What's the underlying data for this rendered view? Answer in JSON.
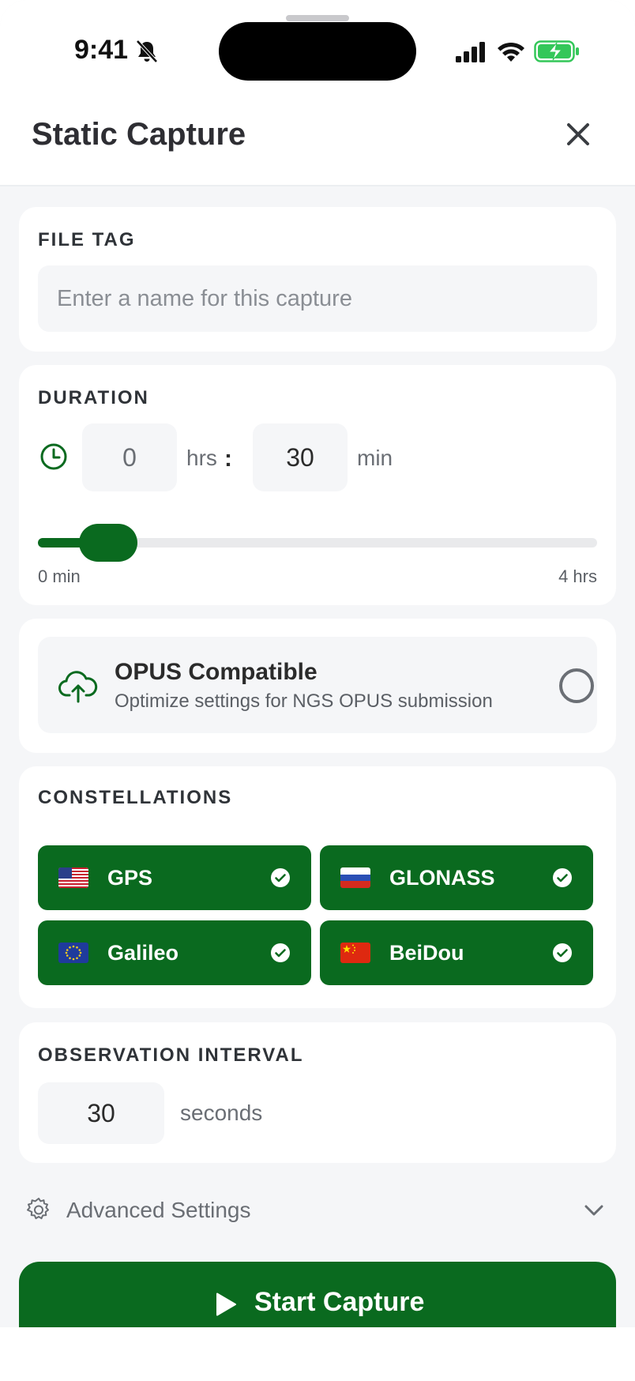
{
  "status_bar": {
    "time": "9:41"
  },
  "header": {
    "title": "Static Capture"
  },
  "file_tag": {
    "label": "FILE TAG",
    "value": "",
    "placeholder": "Enter a name for this capture"
  },
  "duration": {
    "label": "DURATION",
    "hours": "0",
    "hours_unit": "hrs",
    "separator": ":",
    "minutes": "30",
    "minutes_unit": "min",
    "slider_min_label": "0 min",
    "slider_max_label": "4 hrs",
    "slider_value_minutes": 30,
    "slider_max_minutes": 240
  },
  "opus": {
    "title": "OPUS Compatible",
    "subtitle": "Optimize settings for NGS OPUS submission",
    "selected": false
  },
  "constellations": {
    "label": "CONSTELLATIONS",
    "items": [
      {
        "name": "GPS",
        "flag": "us-flag",
        "selected": true
      },
      {
        "name": "GLONASS",
        "flag": "ru-flag",
        "selected": true
      },
      {
        "name": "Galileo",
        "flag": "eu-flag",
        "selected": true
      },
      {
        "name": "BeiDou",
        "flag": "cn-flag",
        "selected": true
      }
    ]
  },
  "observation_interval": {
    "label": "OBSERVATION INTERVAL",
    "value": "30",
    "unit": "seconds"
  },
  "advanced": {
    "label": "Advanced Settings"
  },
  "actions": {
    "start_label": "Start Capture"
  },
  "colors": {
    "accent": "#0a6a1f",
    "background": "#f5f6f8",
    "card": "#ffffff"
  }
}
